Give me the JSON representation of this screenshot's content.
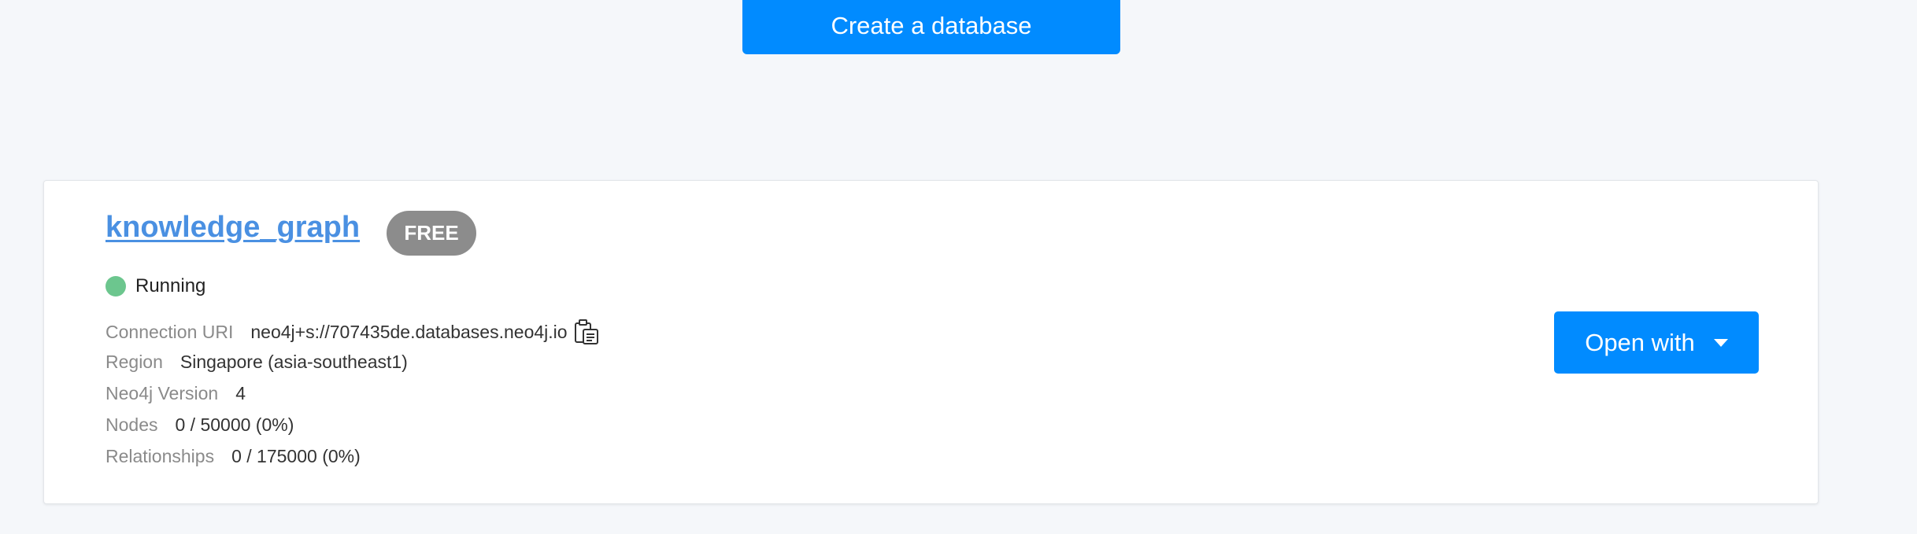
{
  "header": {
    "create_button_label": "Create a database"
  },
  "database": {
    "name": "knowledge_graph",
    "tier_badge": "FREE",
    "status": {
      "text": "Running",
      "color": "#6cc68e"
    },
    "details": [
      {
        "label": "Connection URI",
        "value": "neo4j+s://707435de.databases.neo4j.io"
      },
      {
        "label": "Region",
        "value": "Singapore (asia-southeast1)"
      },
      {
        "label": "Neo4j Version",
        "value": "4"
      },
      {
        "label": "Nodes",
        "value": "0 / 50000 (0%)"
      },
      {
        "label": "Relationships",
        "value": "0 / 175000 (0%)"
      }
    ],
    "copy_icon": "clipboard-icon",
    "open_button_label": "Open with",
    "open_button_icon": "caret-down-icon"
  },
  "colors": {
    "primary": "#018bff",
    "link": "#4a90e2",
    "badge": "#8c8c8c",
    "background": "#f5f7fa"
  }
}
